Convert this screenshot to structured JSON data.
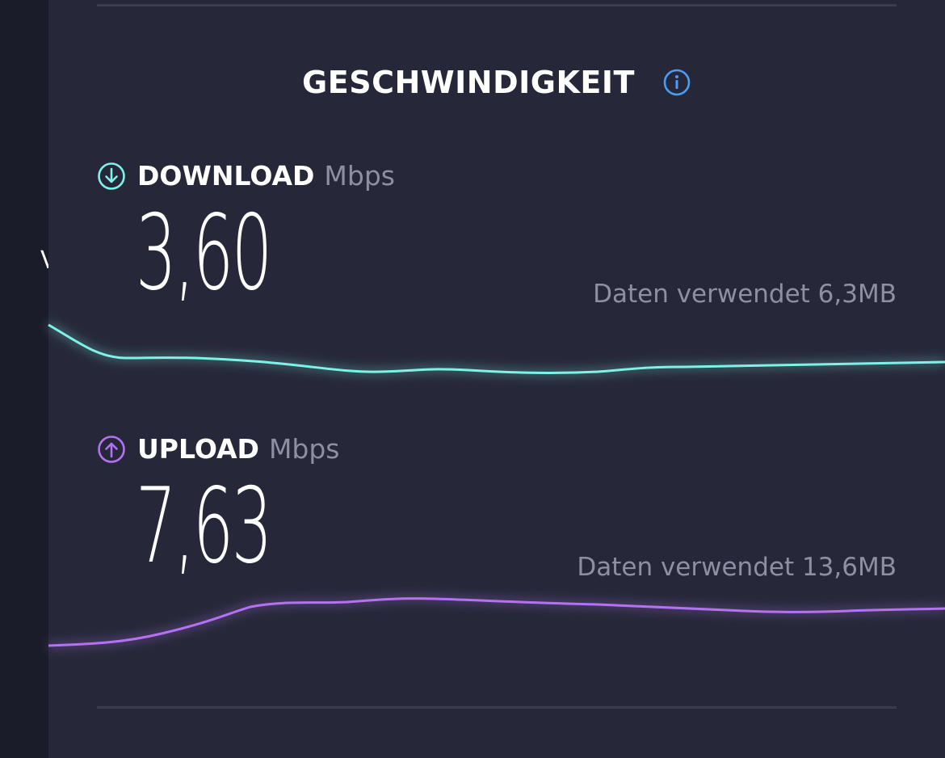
{
  "section": {
    "title": "GESCHWINDIGKEIT",
    "info_icon": "info-icon"
  },
  "left_strip": {
    "glyph": "V"
  },
  "download": {
    "icon": "arrow-down-circle-icon",
    "label": "DOWNLOAD",
    "unit": "Mbps",
    "value": "3,60",
    "data_used": "Daten verwendet 6,3MB",
    "color": "#7ef2e8"
  },
  "upload": {
    "icon": "arrow-up-circle-icon",
    "label": "UPLOAD",
    "unit": "Mbps",
    "value": "7,63",
    "data_used": "Daten verwendet 13,6MB",
    "color": "#b472f2"
  },
  "colors": {
    "background": "#262839",
    "info_accent": "#4a9cf5",
    "muted_text": "#8d8fa3"
  }
}
